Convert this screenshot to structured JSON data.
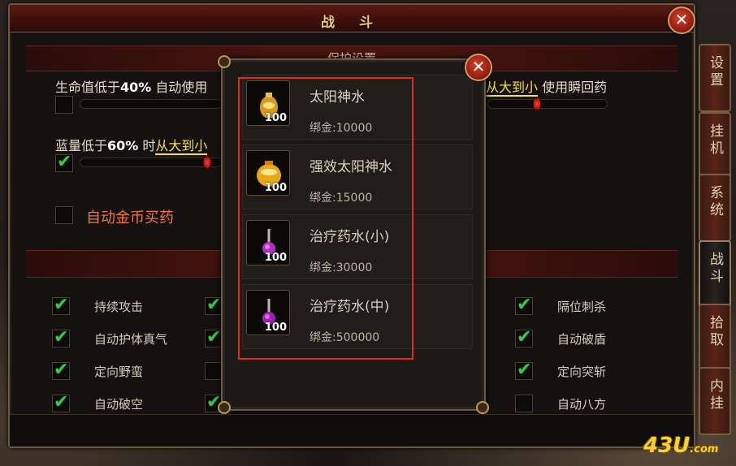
{
  "window": {
    "title": "战 斗",
    "close_label": "✕"
  },
  "section": {
    "protect_title": "保护设置"
  },
  "hp_row": {
    "prefix": "生命值低于",
    "percent": "40%",
    "suffix": "自动使用",
    "order_link": "从大到小",
    "tail": "使用瞬回药",
    "slider_fraction": 0.82
  },
  "mp_row": {
    "prefix": "蓝量低于",
    "percent": "60%",
    "mid": "时",
    "order_link": "从大到小",
    "slider_fraction": 0.86
  },
  "gold_buy": {
    "label": "自动金币买药",
    "checked": false
  },
  "options": {
    "col1": [
      {
        "label": "持续攻击",
        "checked": true
      },
      {
        "label": "自动护体真气",
        "checked": true
      },
      {
        "label": "定向野蛮",
        "checked": true
      },
      {
        "label": "自动破空",
        "checked": true
      }
    ],
    "col3": [
      {
        "label": "隔位刺杀",
        "checked": true
      },
      {
        "label": "自动破盾",
        "checked": true
      },
      {
        "label": "定向突斩",
        "checked": true
      },
      {
        "label": "自动八方",
        "checked": false
      }
    ]
  },
  "side_tabs": [
    {
      "label": "设置",
      "active": false
    },
    {
      "label": "挂机",
      "active": false
    },
    {
      "label": "系统",
      "active": false
    },
    {
      "label": "战斗",
      "active": true
    },
    {
      "label": "拾取",
      "active": false
    },
    {
      "label": "内挂",
      "active": false
    }
  ],
  "popup": {
    "close_label": "✕",
    "items": [
      {
        "name": "太阳神水",
        "count": "100",
        "price": "绑金:10000",
        "icon": "sun-potion-icon"
      },
      {
        "name": "强效太阳神水",
        "count": "100",
        "price": "绑金:15000",
        "icon": "strong-sun-potion-icon"
      },
      {
        "name": "治疗药水(小)",
        "count": "100",
        "price": "绑金:30000",
        "icon": "small-heal-potion-icon"
      },
      {
        "name": "治疗药水(中)",
        "count": "100",
        "price": "绑金:500000",
        "icon": "medium-heal-potion-icon"
      }
    ]
  },
  "watermark": {
    "main": "43U",
    "suffix": ".com"
  },
  "colors": {
    "accent_red": "#e02a20",
    "check_green": "#3cc84a",
    "link_yellow": "#f4e040"
  }
}
